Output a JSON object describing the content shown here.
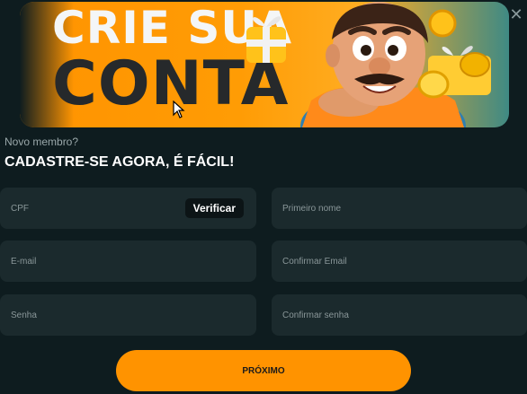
{
  "banner": {
    "title_line1": "CRIE SUA",
    "title_line2": "CONTA",
    "accent_color": "#ff9300",
    "illustration": [
      "mascot",
      "gift-box",
      "coins"
    ]
  },
  "close_icon": "close-icon",
  "subtitle": "Novo membro?",
  "heading": "CADASTRE-SE AGORA, É FÁCIL!",
  "form": {
    "cpf_placeholder": "CPF",
    "verify_label": "Verificar",
    "first_name_placeholder": "Primeiro nome",
    "email_placeholder": "E-mail",
    "confirm_email_placeholder": "Confirmar Email",
    "password_placeholder": "Senha",
    "confirm_password_placeholder": "Confirmar senha"
  },
  "next_button": "PRÓXIMO"
}
